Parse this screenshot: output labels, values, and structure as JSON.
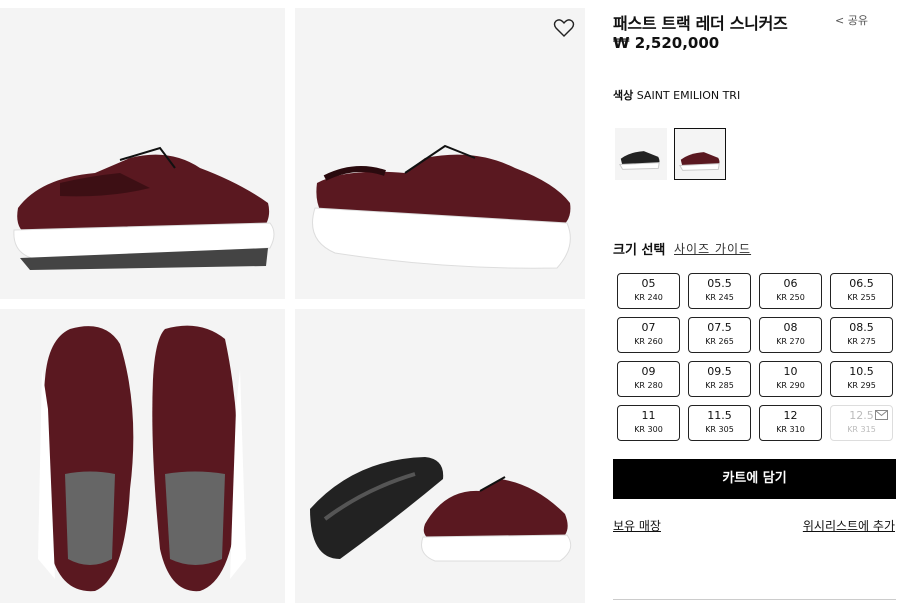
{
  "product": {
    "title": "패스트 트랙 레더 스니커즈",
    "price": "₩ 2,520,000",
    "share_label": "공유",
    "color_label": "색상",
    "color_value": "SAINT EMILION TRI"
  },
  "colors": {
    "leather": "#5a1820",
    "leather_dark": "#2a0a0e",
    "sole": "#ffffff",
    "tread": "#222222",
    "button_bg": "#000000"
  },
  "size": {
    "heading": "크기 선택",
    "guide_label": "사이즈 가이드",
    "options": [
      {
        "us": "05",
        "kr": "KR 240",
        "available": true
      },
      {
        "us": "05.5",
        "kr": "KR 245",
        "available": true
      },
      {
        "us": "06",
        "kr": "KR 250",
        "available": true
      },
      {
        "us": "06.5",
        "kr": "KR 255",
        "available": true
      },
      {
        "us": "07",
        "kr": "KR 260",
        "available": true
      },
      {
        "us": "07.5",
        "kr": "KR 265",
        "available": true
      },
      {
        "us": "08",
        "kr": "KR 270",
        "available": true
      },
      {
        "us": "08.5",
        "kr": "KR 275",
        "available": true
      },
      {
        "us": "09",
        "kr": "KR 280",
        "available": true
      },
      {
        "us": "09.5",
        "kr": "KR 285",
        "available": true
      },
      {
        "us": "10",
        "kr": "KR 290",
        "available": true
      },
      {
        "us": "10.5",
        "kr": "KR 295",
        "available": true
      },
      {
        "us": "11",
        "kr": "KR 300",
        "available": true
      },
      {
        "us": "11.5",
        "kr": "KR 305",
        "available": true
      },
      {
        "us": "12",
        "kr": "KR 310",
        "available": true
      },
      {
        "us": "12.5",
        "kr": "KR 315",
        "available": false
      }
    ]
  },
  "actions": {
    "add_to_cart": "카트에 담기",
    "stores": "보유 매장",
    "wishlist": "위시리스트에 추가"
  }
}
